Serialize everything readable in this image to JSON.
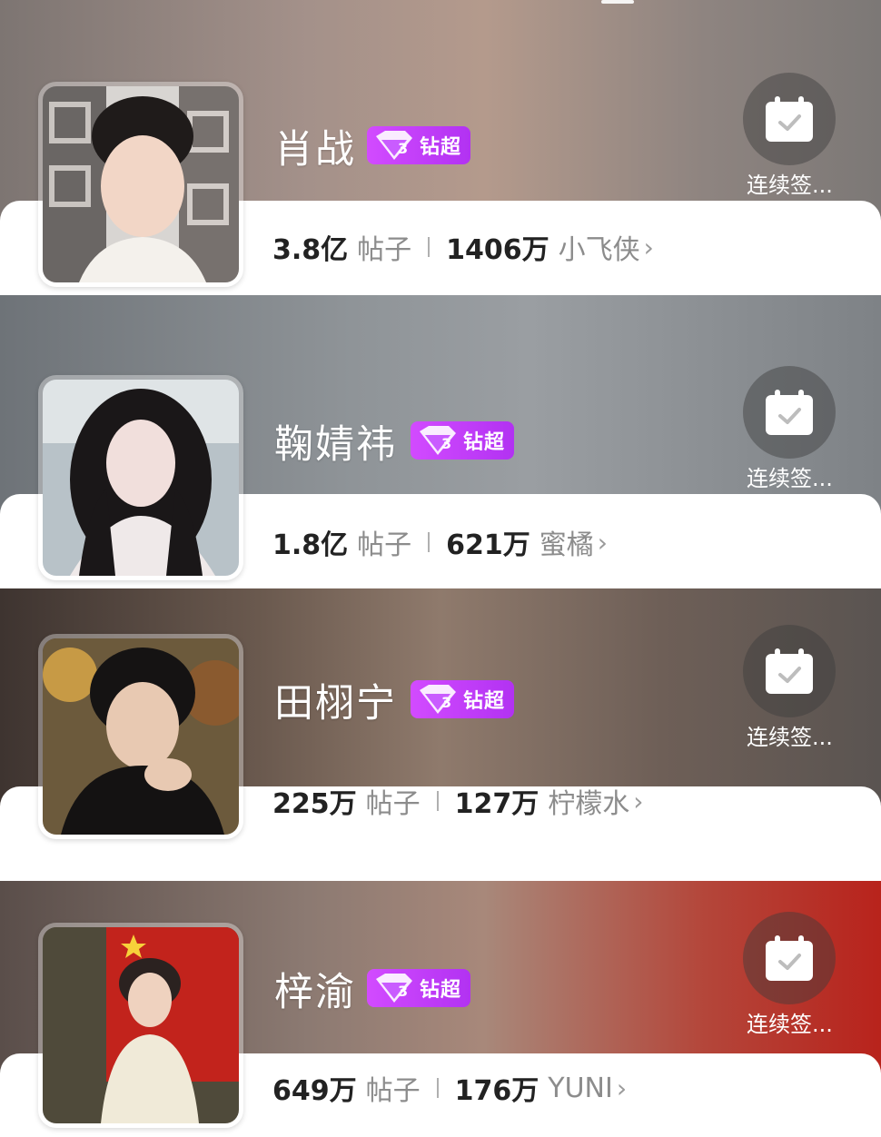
{
  "badge_label": "钻超",
  "checkin_label": "连续签...",
  "posts_label": "帖子",
  "colors": {
    "badge": "#c43ef8",
    "panel": "#ffffff",
    "number": "#222222",
    "label": "#8c8c8c"
  },
  "icons": {
    "badge": "diamond-gem-icon",
    "checkin": "calendar-check-icon",
    "more": "chevron-right-icon"
  },
  "cards": [
    {
      "name": "肖战",
      "posts": "3.8亿",
      "fans": "1406万",
      "fan_name": "小飞侠",
      "chevron": "›"
    },
    {
      "name": "鞠婧祎",
      "posts": "1.8亿",
      "fans": "621万",
      "fan_name": "蜜橘",
      "chevron": "›"
    },
    {
      "name": "田栩宁",
      "posts": "225万",
      "fans": "127万",
      "fan_name": "柠檬水",
      "chevron": "›"
    },
    {
      "name": "梓渝",
      "posts": "649万",
      "fans": "176万",
      "fan_name": "YUNI",
      "chevron": "›"
    }
  ]
}
